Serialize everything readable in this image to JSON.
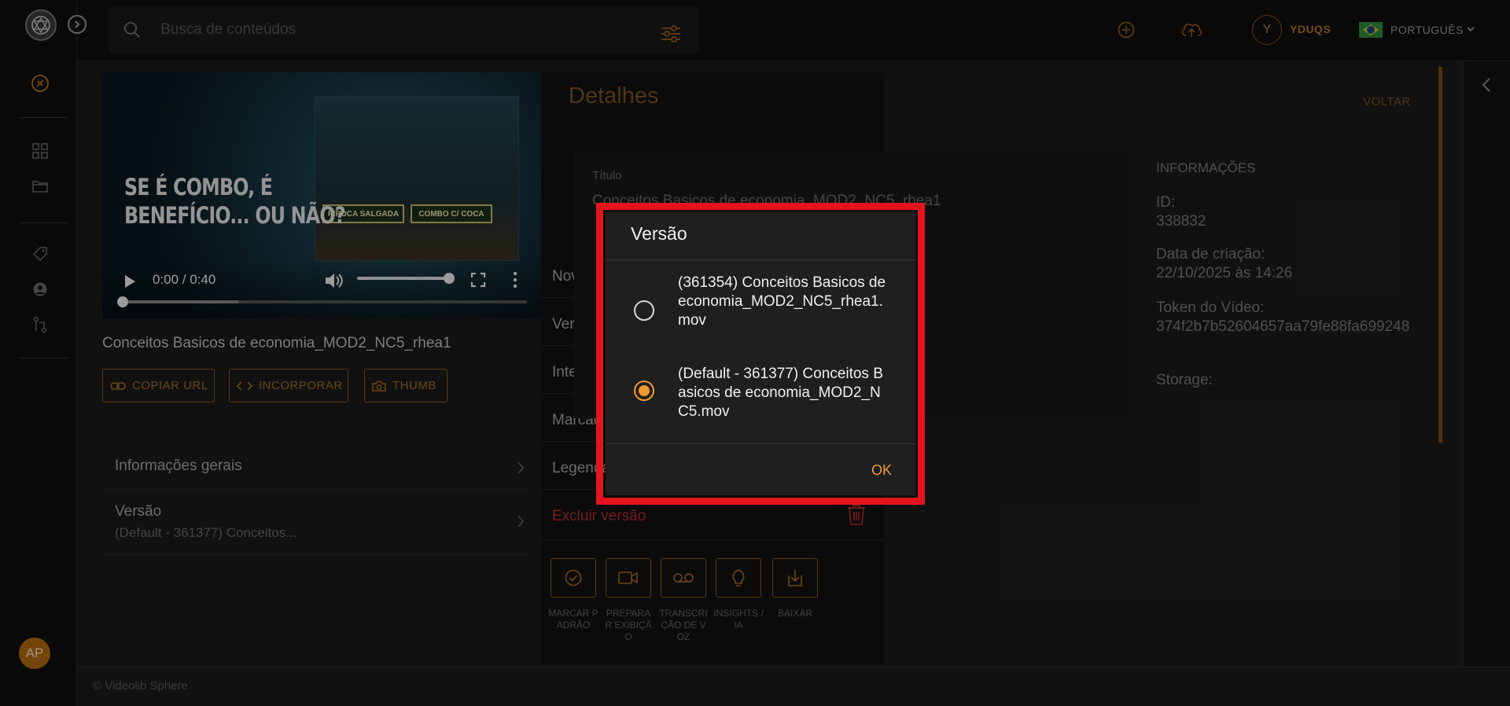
{
  "topbar": {
    "search_placeholder": "Busca de conteúdos",
    "user_initial": "Y",
    "user_name": "YDUQS",
    "language": "PORTUGUÊS"
  },
  "sidebar": {
    "avatar_initials": "AP"
  },
  "video": {
    "overlay_text": "SE É COMBO, É\nBENEFÍCIO... OU NÃO?",
    "sign_left": "PIPOCA SALGADA",
    "sign_right": "COMBO C/ COCA",
    "time": "0:00 / 0:40",
    "progress_fraction": 0,
    "volume_fraction": 1.0,
    "title": "Conceitos Basicos de economia_MOD2_NC5_rhea1"
  },
  "buttons": {
    "copy_url": "COPIAR URL",
    "embed": "INCORPORAR",
    "thumb": "THUMB"
  },
  "accordion": {
    "general_info": "Informações gerais",
    "version_label": "Versão",
    "version_value": "(Default - 361377) Conceitos..."
  },
  "panel": {
    "rows": [
      "Nova ve",
      "Versão",
      "Intelige",
      "Marcaç",
      "Legenda"
    ],
    "delete_version": "Excluir versão",
    "actions": [
      {
        "label": "MARCAR PADRÃO",
        "icon": "check-circle-icon"
      },
      {
        "label": "PREPARAR EXIBIÇÃO",
        "icon": "video-camera-icon"
      },
      {
        "label": "TRANSCRIÇÃO DE VOZ",
        "icon": "voicemail-icon"
      },
      {
        "label": "INSIGHTS /IA",
        "icon": "lightbulb-icon"
      },
      {
        "label": "BAIXAR",
        "icon": "download-icon"
      }
    ]
  },
  "details": {
    "title": "Detalhes",
    "back": "VOLTAR",
    "field_label": "Título",
    "field_value": "Conceitos Basicos de economia_MOD2_NC5_rhea1",
    "info_heading": "INFORMAÇÕES",
    "id_label": "ID:",
    "id_value": "338832",
    "created_label": "Data de criação:",
    "created_value": "22/10/2025 às 14:26",
    "token_label": "Token do Vídeo:",
    "token_value": "374f2b7b52604657aa79fe88fa699248",
    "storage_label": "Storage:"
  },
  "dialog": {
    "title": "Versão",
    "options": [
      {
        "label": "(361354) Conceitos Basicos de economia_MOD2_NC5_rhea1.mov",
        "selected": false
      },
      {
        "label": "(Default - 361377) Conceitos Basicos de economia_MOD2_NC5.mov",
        "selected": true
      }
    ],
    "ok": "OK"
  },
  "footer": {
    "copyright": "© Videolib Sphere"
  },
  "colors": {
    "accent": "#f19a2c",
    "highlight": "#e4141e",
    "danger": "#b32c2c"
  }
}
